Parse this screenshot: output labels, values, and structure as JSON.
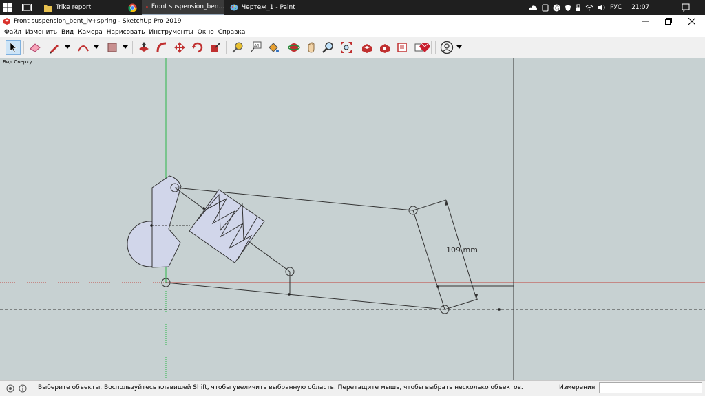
{
  "taskbar": {
    "tasks": [
      {
        "label": "Trike report"
      },
      {
        "label": ""
      },
      {
        "label": "Front suspension_ben..."
      },
      {
        "label": "Чертеж_1 - Paint"
      }
    ],
    "lang": "РУС",
    "time": "21:07"
  },
  "window": {
    "title": "Front suspension_bent_lv+spring - SketchUp Pro 2019"
  },
  "menu": [
    "Файл",
    "Изменить",
    "Вид",
    "Камера",
    "Нарисовать",
    "Инструменты",
    "Окно",
    "Справка"
  ],
  "viewport": {
    "scene_label": "Вид Сверху",
    "dimension_label": "109 mm",
    "axis_colors": {
      "green": "#2db84a",
      "red": "#c0413b"
    },
    "background": "#c7d1d2"
  },
  "status": {
    "hint": "Выберите объекты. Воспользуйтесь клавишей Shift, чтобы увеличить выбранную область. Перетащите мышь, чтобы выбрать несколько объектов.",
    "measure_label": "Измерения",
    "measure_value": ""
  }
}
